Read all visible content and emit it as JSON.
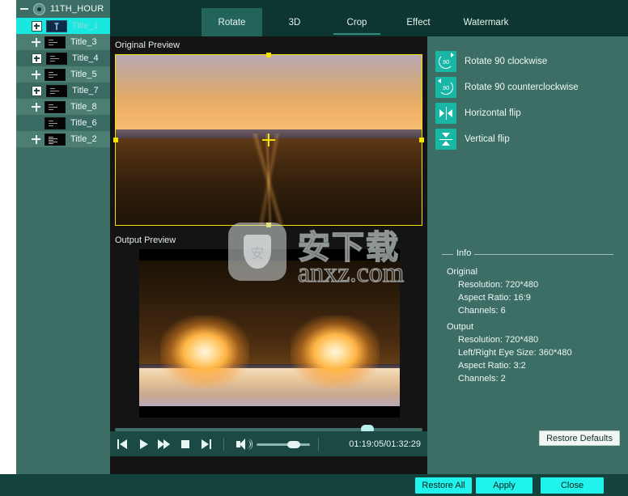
{
  "sidebar": {
    "root": {
      "label": "11TH_HOUR",
      "toggle": "minus-toggle",
      "disc_icon": "disc-icon"
    },
    "items": [
      {
        "label": "Title_1",
        "expander": "plus-boxed",
        "thumb": "blue-arrow-thumb",
        "selected": true
      },
      {
        "label": "Title_3",
        "expander": "plus-plain",
        "thumb": "text-thumb",
        "selected": false
      },
      {
        "label": "Title_4",
        "expander": "plus-boxed",
        "thumb": "text-thumb",
        "selected": false
      },
      {
        "label": "Title_5",
        "expander": "plus-plain",
        "thumb": "text-thumb",
        "selected": false
      },
      {
        "label": "Title_7",
        "expander": "plus-boxed",
        "thumb": "text-thumb",
        "selected": false
      },
      {
        "label": "Title_8",
        "expander": "plus-plain",
        "thumb": "text-thumb",
        "selected": false
      },
      {
        "label": "Title_6",
        "expander": "none",
        "thumb": "text-thumb",
        "selected": false
      },
      {
        "label": "Title_2",
        "expander": "plus-plain",
        "thumb": "dense-text-thumb",
        "selected": false
      }
    ]
  },
  "tabs": [
    {
      "label": "Rotate",
      "state": "active"
    },
    {
      "label": "3D",
      "state": "normal"
    },
    {
      "label": "Crop",
      "state": "underlined"
    },
    {
      "label": "Effect",
      "state": "normal"
    },
    {
      "label": "Watermark",
      "state": "normal"
    }
  ],
  "panels": {
    "original_caption": "Original Preview",
    "output_caption": "Output Preview"
  },
  "rotate_actions": [
    {
      "label": "Rotate 90 clockwise",
      "icon": "rotate-cw-90-icon"
    },
    {
      "label": "Rotate 90 counterclockwise",
      "icon": "rotate-ccw-90-icon"
    },
    {
      "label": "Horizontal flip",
      "icon": "horizontal-flip-icon"
    },
    {
      "label": "Vertical flip",
      "icon": "vertical-flip-icon"
    }
  ],
  "info": {
    "legend": "Info",
    "groups": [
      {
        "heading": "Original",
        "items": [
          "Resolution: 720*480",
          "Aspect Ratio: 16:9",
          "Channels: 6"
        ]
      },
      {
        "heading": "Output",
        "items": [
          "Resolution: 720*480",
          "Left/Right Eye Size: 360*480",
          "Aspect Ratio: 3:2",
          "Channels: 2"
        ]
      }
    ]
  },
  "restore_defaults_label": "Restore Defaults",
  "player": {
    "time": "01:19:05/01:32:29",
    "seek_percent": 82,
    "volume_percent": 72,
    "controls": [
      {
        "name": "previous-frame-button",
        "icon": "skip-previous-icon"
      },
      {
        "name": "play-button",
        "icon": "play-icon"
      },
      {
        "name": "fast-forward-button",
        "icon": "fast-forward-icon"
      },
      {
        "name": "stop-button",
        "icon": "stop-icon"
      },
      {
        "name": "next-frame-button",
        "icon": "skip-next-icon"
      }
    ],
    "volume_icon": "speaker-icon"
  },
  "bottom_buttons": [
    {
      "label": "Restore All"
    },
    {
      "label": "Apply"
    },
    {
      "label": "Close"
    }
  ],
  "watermark": {
    "cn": "安下载",
    "domain": "anxz.com",
    "badge_glyph": "安"
  },
  "colors": {
    "accent_cyan": "#1ff3ec",
    "panel_teal": "#3d6e65",
    "tabbar_dark": "#0d3630",
    "selection_cyan": "#19e8e0",
    "crop_yellow": "#f2e400",
    "icon_teal": "#18b6a5"
  }
}
